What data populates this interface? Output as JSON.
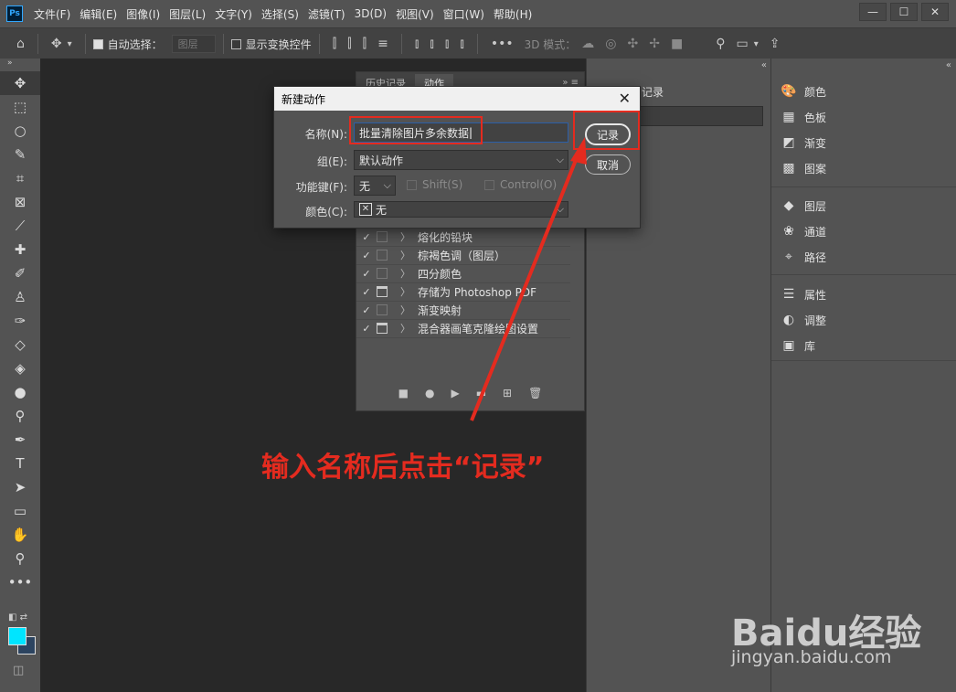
{
  "app": {
    "logo": "Ps"
  },
  "menu": [
    "文件(F)",
    "编辑(E)",
    "图像(I)",
    "图层(L)",
    "文字(Y)",
    "选择(S)",
    "滤镜(T)",
    "3D(D)",
    "视图(V)",
    "窗口(W)",
    "帮助(H)"
  ],
  "options_bar": {
    "auto_select_label": "自动选择：",
    "auto_select_value": "图层",
    "transform_label": "显示变换控件",
    "mode_3d_label": "3D 模式："
  },
  "actions_panel": {
    "tabs": [
      "历史记录",
      "动作"
    ],
    "rows": [
      {
        "label": "熔化的铅块",
        "icon": "none"
      },
      {
        "label": "棕褐色调（图层）",
        "icon": "none"
      },
      {
        "label": "四分颜色",
        "icon": "none"
      },
      {
        "label": "存储为 Photoshop PDF",
        "icon": "dialog"
      },
      {
        "label": "渐变映射",
        "icon": "none"
      },
      {
        "label": "混合器画笔克隆绘图设置",
        "icon": "dialog"
      }
    ]
  },
  "mid_panel": {
    "label": "记录"
  },
  "right_panel": {
    "group1": [
      "颜色",
      "色板",
      "渐变",
      "图案"
    ],
    "group2": [
      "图层",
      "通道",
      "路径"
    ],
    "group3": [
      "属性",
      "调整",
      "库"
    ]
  },
  "dialog": {
    "title": "新建动作",
    "name_label": "名称(N):",
    "name_value": "批量清除图片多余数据",
    "set_label": "组(E):",
    "set_value": "默认动作",
    "fkey_label": "功能键(F):",
    "fkey_value": "无",
    "shift_label": "Shift(S)",
    "control_label": "Control(O)",
    "color_label": "颜色(C):",
    "color_value": "无",
    "record_button": "记录",
    "cancel_button": "取消"
  },
  "annotation": {
    "text": "输入名称后点击“记录”",
    "color": "#e42b1f"
  },
  "watermark": {
    "logo": "Baidu经验",
    "url": "jingyan.baidu.com"
  },
  "colors": {
    "foreground": "#00e5ff",
    "background": "#2c4460",
    "accent_red": "#e42b1f"
  }
}
